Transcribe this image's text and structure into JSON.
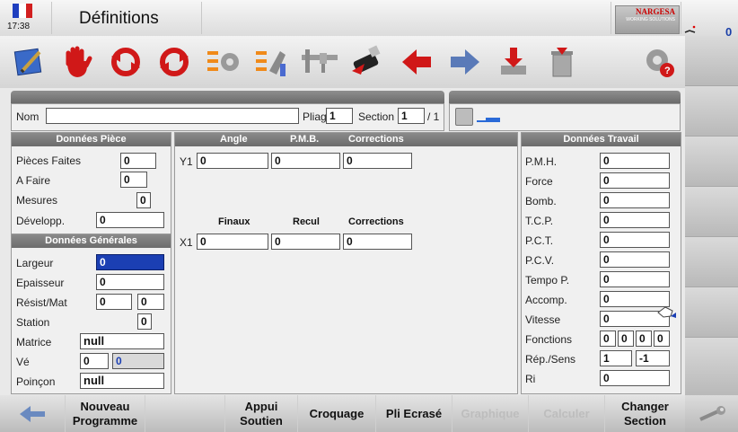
{
  "header": {
    "clock": "17:38",
    "title": "Définitions",
    "logo_brand": "NARGESA",
    "logo_sub": "WORKING SOLUTIONS",
    "status_value": "0",
    "colors": {
      "flag_blue": "#1f3fbf",
      "flag_red": "#d21f1f",
      "accent_selected": "#1b3fb3"
    }
  },
  "toolbar": {
    "icons": [
      "edit-icon",
      "hand-stop-icon",
      "rotate-left-icon",
      "rotate-right-icon",
      "gears-list-icon",
      "bend-list-icon",
      "caliper-icon",
      "usb-icon",
      "arrow-left-red-icon",
      "arrow-right-blue-icon",
      "import-icon",
      "trash-icon",
      "settings-alert-icon"
    ]
  },
  "piece_header": {
    "nom_label": "Nom",
    "nom_value": "",
    "pliage_label": "Pliage",
    "pliage_value": "1",
    "section_label": "Section",
    "section_value": "1",
    "section_total": "/ 1"
  },
  "donnees_piece": {
    "title": "Données Pièce",
    "rows": [
      {
        "label": "Pièces Faites",
        "value": "0"
      },
      {
        "label": "A Faire",
        "value": "0"
      },
      {
        "label": "Mesures",
        "value": "0"
      },
      {
        "label": "Développ.",
        "value": "0"
      }
    ]
  },
  "donnees_generales": {
    "title": "Données Générales",
    "largeur_label": "Largeur",
    "largeur_value": "0",
    "epaisseur_label": "Epaisseur",
    "epaisseur_value": "0",
    "resist_label": "Résist/Mat",
    "resist_value": "0",
    "mat_value": "0",
    "station_label": "Station",
    "station_value": "0",
    "matrice_label": "Matrice",
    "matrice_value": "null",
    "ve_label": "Vé",
    "ve_value": "0",
    "ve_value2": "0",
    "poincon_label": "Poinçon",
    "poincon_value": "null"
  },
  "center": {
    "y_headers": {
      "angle": "Angle",
      "pmb": "P.M.B.",
      "corrections": "Corrections"
    },
    "y1_label": "Y1",
    "y1_angle": "0",
    "y1_pmb": "0",
    "y1_corr": "0",
    "x_headers": {
      "finaux": "Finaux",
      "recul": "Recul",
      "corrections": "Corrections"
    },
    "x1_label": "X1",
    "x1_finaux": "0",
    "x1_recul": "0",
    "x1_corr": "0"
  },
  "donnees_travail": {
    "title": "Données Travail",
    "rows": [
      {
        "label": "P.M.H.",
        "value": "0"
      },
      {
        "label": "Force",
        "value": "0"
      },
      {
        "label": "Bomb.",
        "value": "0"
      },
      {
        "label": "T.C.P.",
        "value": "0"
      },
      {
        "label": "P.C.T.",
        "value": "0"
      },
      {
        "label": "P.C.V.",
        "value": "0"
      },
      {
        "label": "Tempo P.",
        "value": "0"
      },
      {
        "label": "Accomp.",
        "value": "0"
      },
      {
        "label": "Vitesse",
        "value": "0"
      }
    ],
    "fonctions_label": "Fonctions",
    "fonctions_values": [
      "0",
      "0",
      "0",
      "0"
    ],
    "rep_label": "Rép./Sens",
    "rep_value": "1",
    "sens_value": "-1",
    "ri_label": "Ri",
    "ri_value": "0"
  },
  "bottom": {
    "nouveau_l1": "Nouveau",
    "nouveau_l2": "Programme",
    "appui_l1": "Appui",
    "appui_l2": "Soutien",
    "croquage": "Croquage",
    "pli_ecrase": "Pli Ecrasé",
    "graphique": "Graphique",
    "calculer": "Calculer",
    "changer_l1": "Changer",
    "changer_l2": "Section"
  }
}
